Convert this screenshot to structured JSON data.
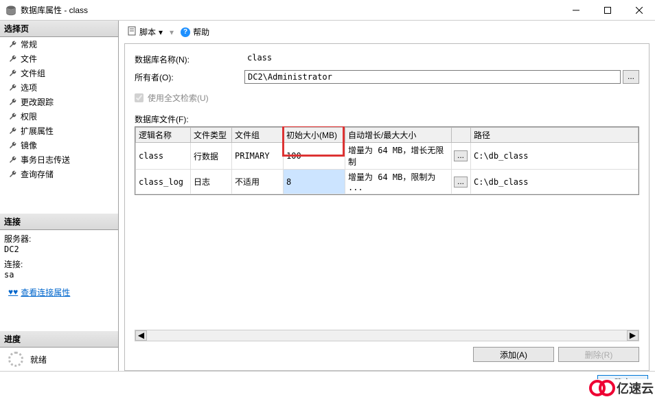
{
  "title": "数据库属性 - class",
  "left": {
    "select_header": "选择页",
    "items": [
      "常规",
      "文件",
      "文件组",
      "选项",
      "更改跟踪",
      "权限",
      "扩展属性",
      "镜像",
      "事务日志传送",
      "查询存储"
    ],
    "connect_header": "连接",
    "server_label": "服务器:",
    "server_value": "DC2",
    "conn_label": "连接:",
    "conn_value": "sa",
    "view_props": "查看连接属性",
    "progress_header": "进度",
    "progress_value": "就绪"
  },
  "toolbar": {
    "script": "脚本",
    "help": "帮助"
  },
  "form": {
    "dbname_label": "数据库名称(N):",
    "dbname_value": "class",
    "owner_label": "所有者(O):",
    "owner_value": "DC2\\Administrator",
    "fulltext_label": "使用全文检索(U)",
    "files_label": "数据库文件(F):"
  },
  "grid": {
    "headers": [
      "逻辑名称",
      "文件类型",
      "文件组",
      "初始大小(MB)",
      "自动增长/最大大小",
      "",
      "路径"
    ],
    "rows": [
      {
        "name": "class",
        "type": "行数据",
        "group": "PRIMARY",
        "size": "100",
        "growth": "增量为 64 MB，增长无限制",
        "btn": "...",
        "path": "C:\\db_class"
      },
      {
        "name": "class_log",
        "type": "日志",
        "group": "不适用",
        "size": "8",
        "growth": "增量为 64 MB，限制为 ...",
        "btn": "...",
        "path": "C:\\db_class"
      }
    ]
  },
  "buttons": {
    "add": "添加(A)",
    "remove": "删除(R)",
    "ok": "确定"
  },
  "brand": "亿速云"
}
